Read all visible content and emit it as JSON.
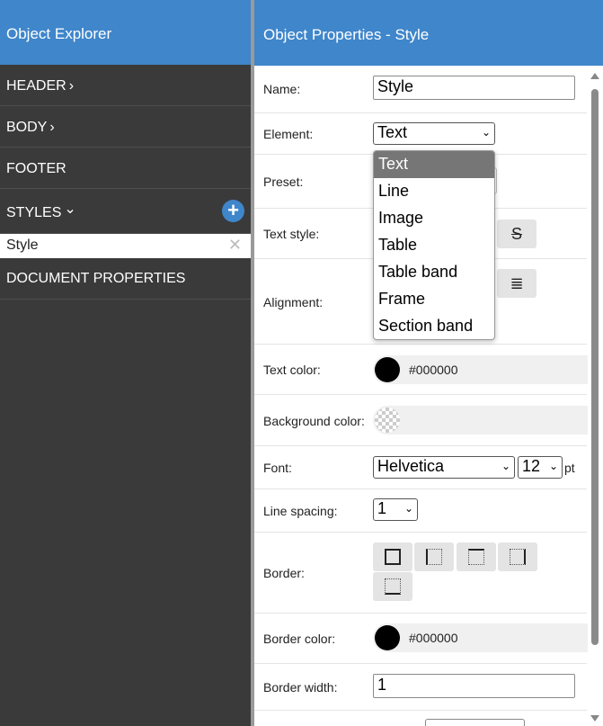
{
  "left": {
    "title": "Object Explorer",
    "nav": {
      "header": "HEADER",
      "body": "BODY",
      "footer": "FOOTER",
      "styles": "STYLES",
      "doc_props": "DOCUMENT PROPERTIES"
    },
    "chev_right": "›",
    "chev_down": "⌄",
    "add_icon": "+",
    "style_item": "Style",
    "remove_icon": "✕"
  },
  "right": {
    "title": "Object Properties - Style",
    "labels": {
      "name": "Name:",
      "element": "Element:",
      "preset": "Preset:",
      "text_style": "Text style:",
      "alignment": "Alignment:",
      "text_color": "Text color:",
      "bg_color": "Background color:",
      "font": "Font:",
      "line_spacing": "Line spacing:",
      "border": "Border:",
      "border_color": "Border color:",
      "border_width": "Border width:"
    },
    "values": {
      "name": "Style",
      "element": "Text",
      "text_color": "#000000",
      "font": "Helvetica",
      "font_size": "12",
      "font_unit": "pt",
      "line_spacing": "1",
      "border_color": "#000000",
      "border_width": "1"
    },
    "strike_icon": "S",
    "justify_icon": "≣"
  },
  "dropdown": {
    "options": [
      "Text",
      "Line",
      "Image",
      "Table",
      "Table band",
      "Frame",
      "Section band"
    ],
    "selected": "Text"
  },
  "colors": {
    "accent": "#3f86cb",
    "sidebar": "#3a3a3a",
    "text_color": "#000000",
    "border_color": "#000000"
  }
}
